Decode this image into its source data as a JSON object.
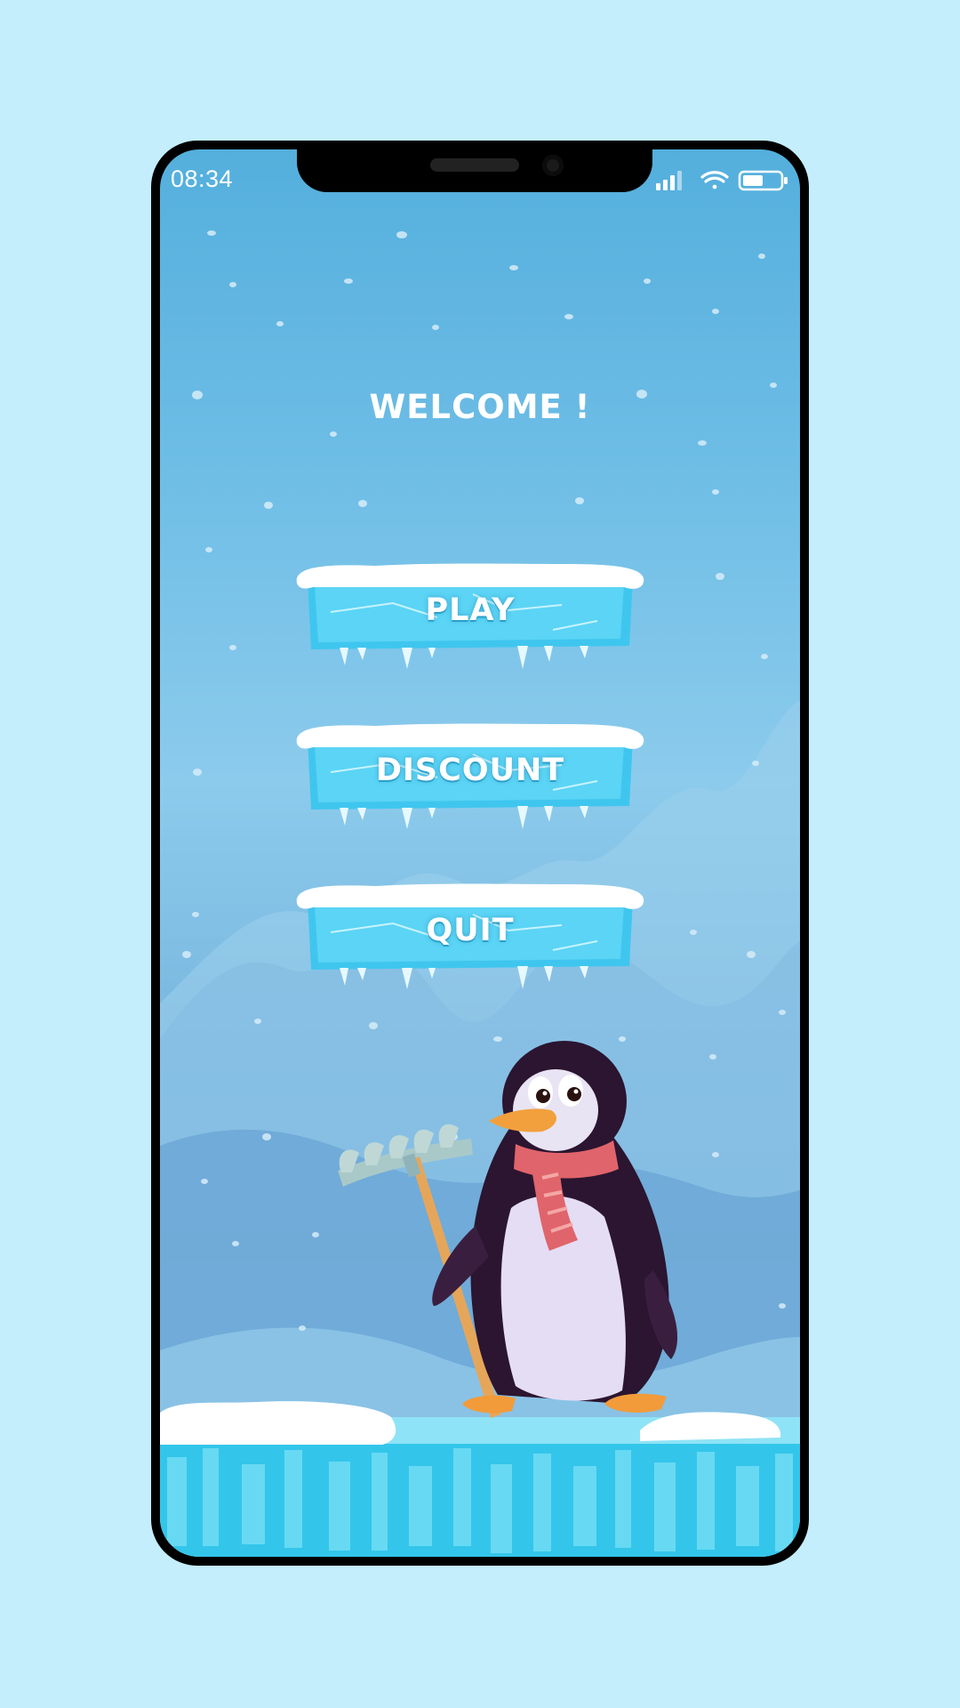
{
  "status_bar": {
    "time": "08:34",
    "icons": [
      "signal-icon",
      "wifi-icon",
      "battery-icon"
    ]
  },
  "menu": {
    "title": "WELCOME !",
    "buttons": [
      {
        "label": "PLAY"
      },
      {
        "label": "DISCOUNT"
      },
      {
        "label": "QUIT"
      }
    ]
  },
  "colors": {
    "page_background": "#c4eefc",
    "sky_top": "#54afdc",
    "ice_button": "#3fc6ef",
    "snow": "#ffffff"
  }
}
